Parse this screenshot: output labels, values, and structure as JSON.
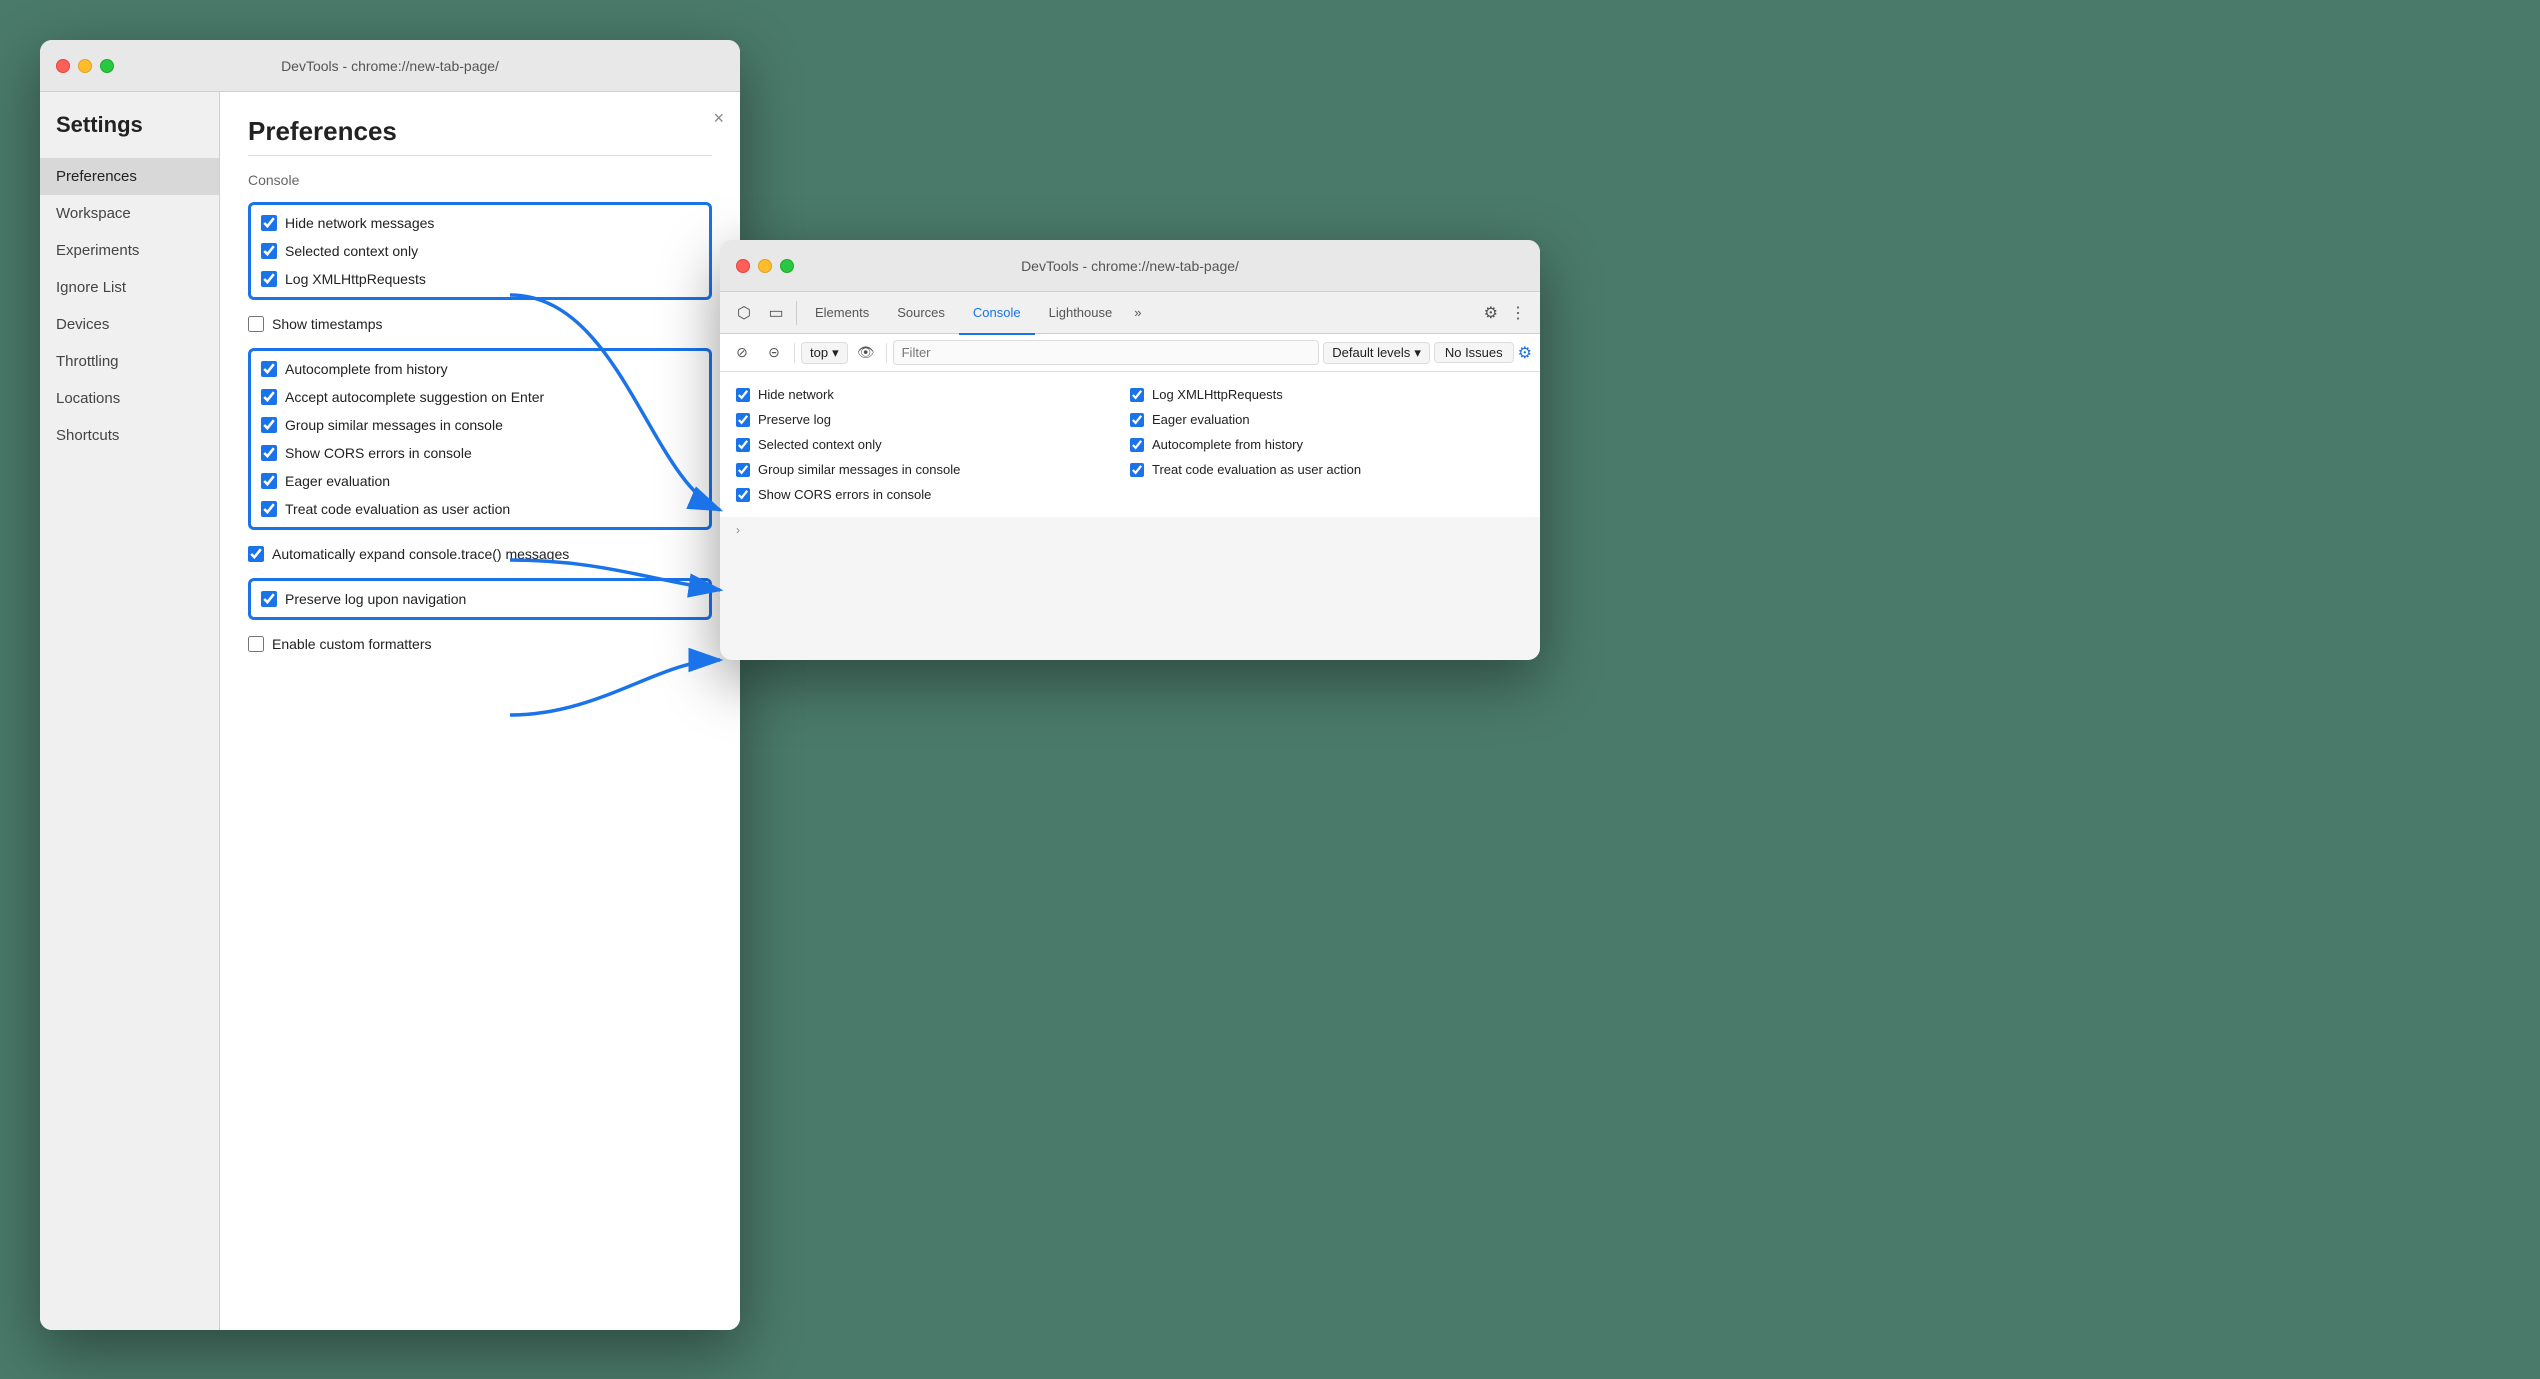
{
  "left_window": {
    "titlebar": "DevTools - chrome://new-tab-page/",
    "close_btn": "×",
    "sidebar": {
      "heading": "Settings",
      "items": [
        {
          "label": "Preferences",
          "active": true
        },
        {
          "label": "Workspace",
          "active": false
        },
        {
          "label": "Experiments",
          "active": false
        },
        {
          "label": "Ignore List",
          "active": false
        },
        {
          "label": "Devices",
          "active": false
        },
        {
          "label": "Throttling",
          "active": false
        },
        {
          "label": "Locations",
          "active": false
        },
        {
          "label": "Shortcuts",
          "active": false
        }
      ]
    },
    "main": {
      "title": "Preferences",
      "section_label": "Console",
      "group1": [
        {
          "label": "Hide network messages",
          "checked": true
        },
        {
          "label": "Selected context only",
          "checked": true
        },
        {
          "label": "Log XMLHttpRequests",
          "checked": true
        }
      ],
      "item_timestamps": {
        "label": "Show timestamps",
        "checked": false
      },
      "group2": [
        {
          "label": "Autocomplete from history",
          "checked": true
        },
        {
          "label": "Accept autocomplete suggestion on Enter",
          "checked": true
        },
        {
          "label": "Group similar messages in console",
          "checked": true
        },
        {
          "label": "Show CORS errors in console",
          "checked": true
        },
        {
          "label": "Eager evaluation",
          "checked": true
        },
        {
          "label": "Treat code evaluation as user action",
          "checked": true
        }
      ],
      "item_expand": {
        "label": "Automatically expand console.trace() messages",
        "checked": true
      },
      "group3": [
        {
          "label": "Preserve log upon navigation",
          "checked": true
        }
      ],
      "item_formatters": {
        "label": "Enable custom formatters",
        "checked": false
      }
    }
  },
  "right_window": {
    "titlebar": "DevTools - chrome://new-tab-page/",
    "tabs": [
      {
        "label": "Elements",
        "active": false
      },
      {
        "label": "Sources",
        "active": false
      },
      {
        "label": "Console",
        "active": true
      },
      {
        "label": "Lighthouse",
        "active": false
      },
      {
        "label": "»",
        "active": false
      }
    ],
    "toolbar": {
      "top_label": "top",
      "filter_placeholder": "Filter",
      "levels_label": "Default levels",
      "issues_label": "No Issues"
    },
    "console_items_col1": [
      {
        "label": "Hide network",
        "checked": true
      },
      {
        "label": "Preserve log",
        "checked": true
      },
      {
        "label": "Selected context only",
        "checked": true
      },
      {
        "label": "Group similar messages in console",
        "checked": true
      },
      {
        "label": "Show CORS errors in console",
        "checked": true
      }
    ],
    "console_items_col2": [
      {
        "label": "Log XMLHttpRequests",
        "checked": true
      },
      {
        "label": "Eager evaluation",
        "checked": true
      },
      {
        "label": "Autocomplete from history",
        "checked": true
      },
      {
        "label": "Treat code evaluation as user action",
        "checked": true
      }
    ]
  }
}
